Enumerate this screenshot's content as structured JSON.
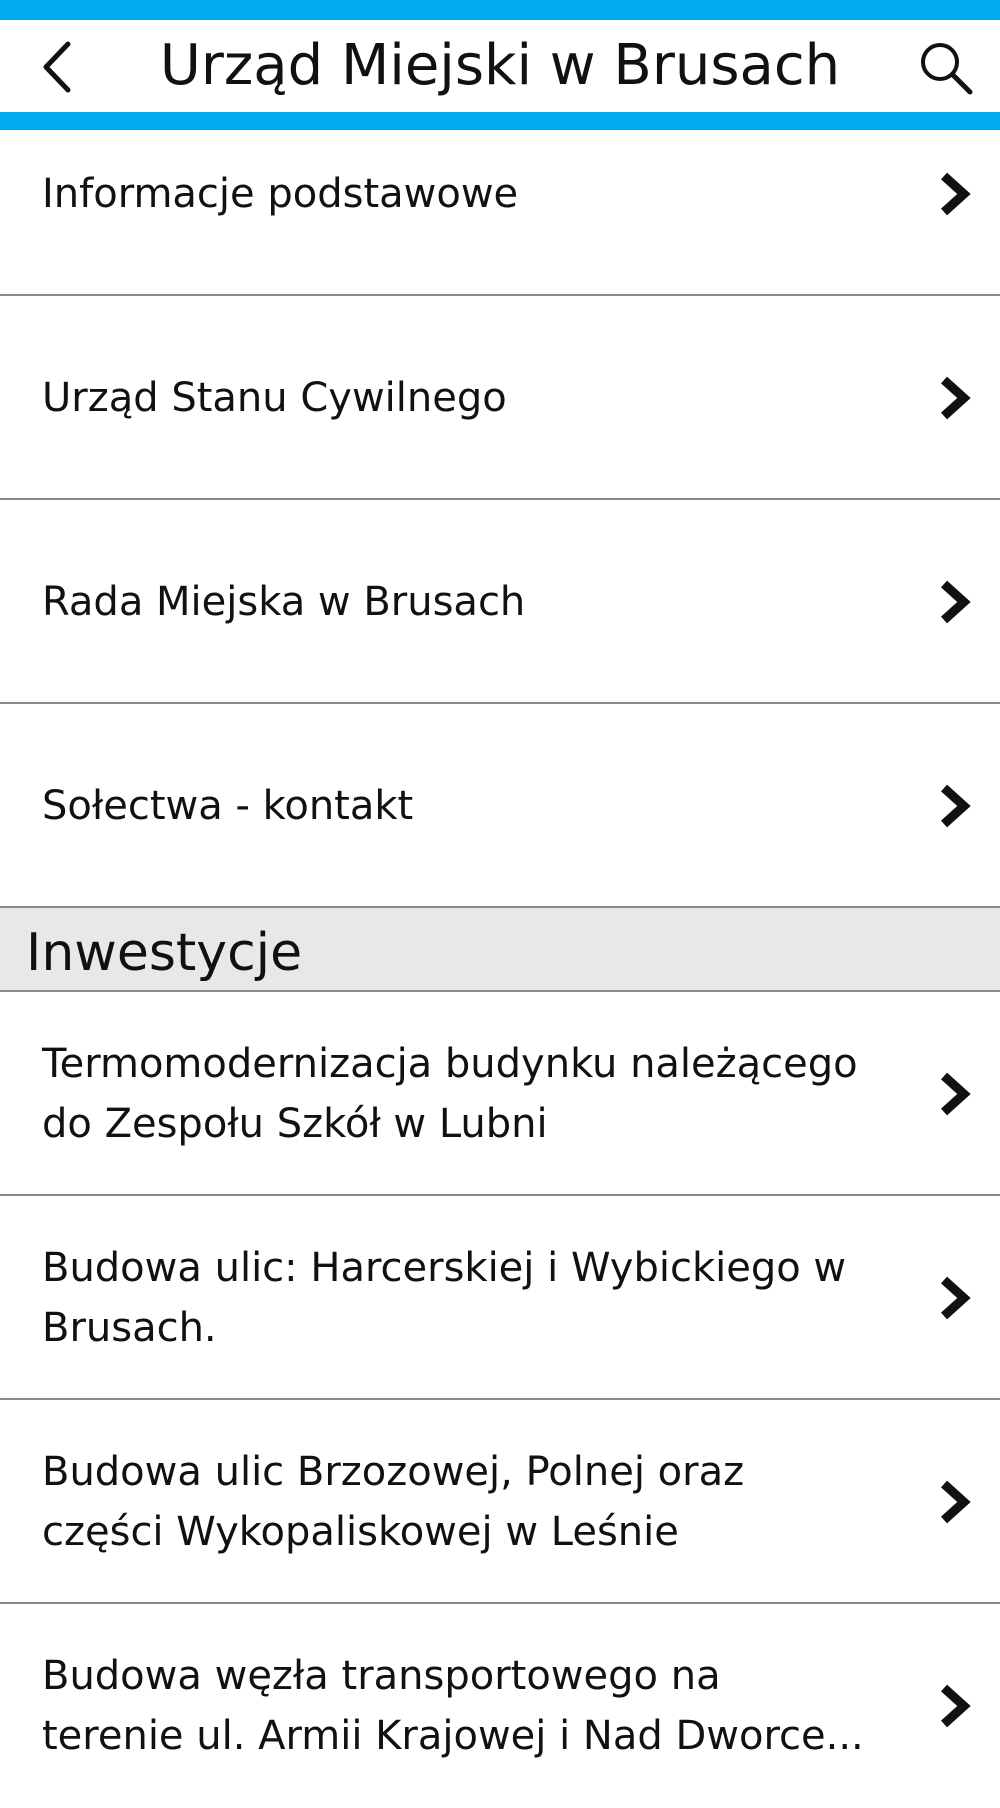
{
  "header": {
    "title": "Urząd Miejski w Brusach",
    "back_icon": "chevron-left-icon",
    "search_icon": "search-icon",
    "accent_color": "#00aaef"
  },
  "items": [
    {
      "label": "Informacje podstawowe"
    },
    {
      "label": "Urząd Stanu Cywilnego"
    },
    {
      "label": "Rada Miejska w Brusach"
    },
    {
      "label": "Sołectwa - kontakt"
    }
  ],
  "section": {
    "title": "Inwestycje"
  },
  "investments": [
    {
      "label": "Termomodernizacja budynku należącego do Zespołu Szkół w Lubni"
    },
    {
      "label": "Budowa ulic: Harcerskiej i Wybickiego w Brusach."
    },
    {
      "label": "Budowa ulic Brzozowej, Polnej oraz części Wykopaliskowej w Leśnie"
    },
    {
      "label": "Budowa węzła transportowego na terenie ul. Armii Krajowej i Nad Dworce..."
    }
  ]
}
